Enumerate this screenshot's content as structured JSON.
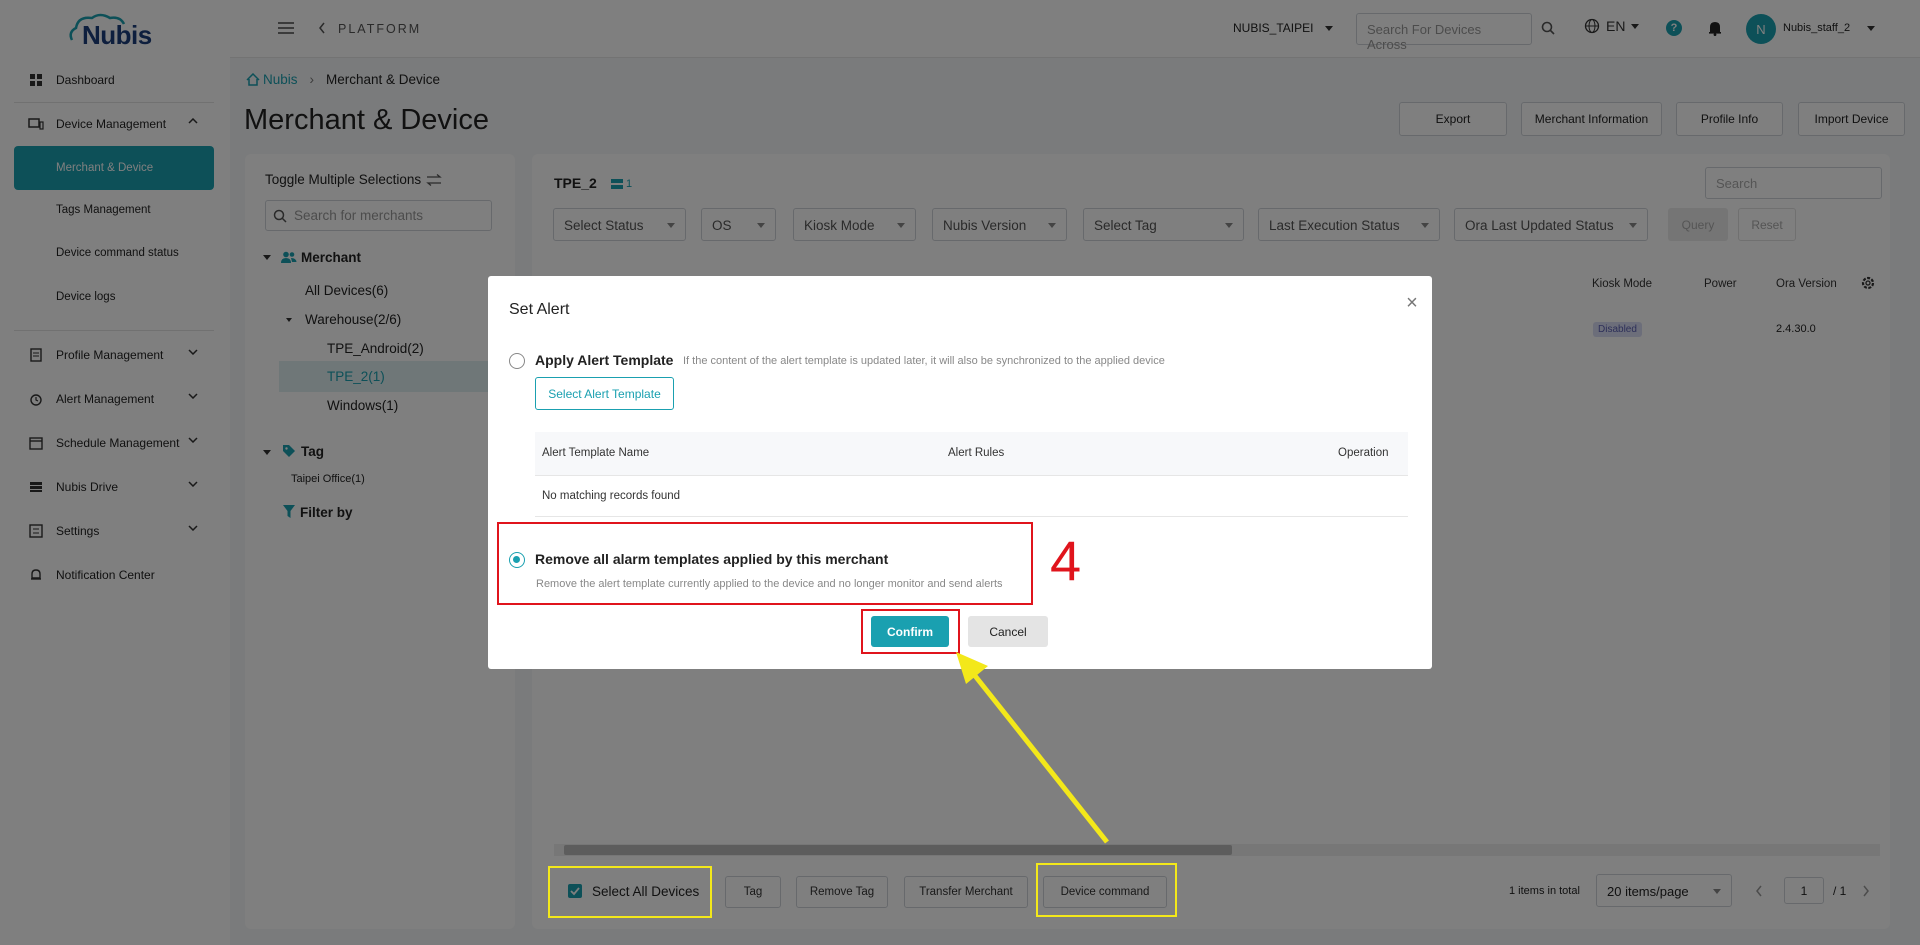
{
  "app": {
    "logo": "Nubis"
  },
  "sidebar": {
    "items": [
      {
        "label": "Dashboard"
      },
      {
        "label": "Device Management"
      },
      {
        "label": "Profile Management"
      },
      {
        "label": "Alert Management"
      },
      {
        "label": "Schedule Management"
      },
      {
        "label": "Nubis Drive"
      },
      {
        "label": "Settings"
      },
      {
        "label": "Notification Center"
      }
    ],
    "sub_items": [
      {
        "label": "Merchant & Device"
      },
      {
        "label": "Tags Management"
      },
      {
        "label": "Device command status"
      },
      {
        "label": "Device logs"
      }
    ]
  },
  "topbar": {
    "section": "PLATFORM",
    "store": "NUBIS_TAIPEI",
    "search_placeholder": "Search For Devices Across",
    "language": "EN",
    "avatar_initial": "N",
    "username": "Nubis_staff_2"
  },
  "page": {
    "breadcrumb_home": "Nubis",
    "breadcrumb_current": "Merchant & Device",
    "title": "Merchant & Device",
    "header_buttons": [
      "Export",
      "Merchant Information",
      "Profile Info",
      "Import Device"
    ]
  },
  "left_panel": {
    "toggle_label": "Toggle Multiple Selections",
    "search_placeholder": "Search for merchants",
    "merchant_heading": "Merchant",
    "all_devices": "All Devices(6)",
    "warehouse": "Warehouse(2/6)",
    "tpe_android": "TPE_Android(2)",
    "tpe_2": "TPE_2(1)",
    "windows": "Windows(1)",
    "tag_heading": "Tag",
    "taipei_office": "Taipei Office(1)",
    "filter_by": "Filter by"
  },
  "right_panel": {
    "title": "TPE_2",
    "count": "1",
    "search_placeholder": "Search",
    "filters": [
      "Select Status",
      "OS",
      "Kiosk Mode",
      "Nubis Version",
      "Select Tag",
      "Last Execution Status",
      "Ora Last Updated Status"
    ],
    "query": "Query",
    "reset": "Reset",
    "columns": [
      "Kiosk Mode",
      "Power",
      "Ora Version"
    ],
    "row": {
      "kiosk": "Disabled",
      "ora": "2.4.30.0"
    }
  },
  "bottom_bar": {
    "select_all": "Select All Devices",
    "tag": "Tag",
    "remove_tag": "Remove Tag",
    "transfer": "Transfer Merchant",
    "device_command": "Device command",
    "total": "1 items in total",
    "page_size": "20 items/page",
    "page": "1",
    "page_total": "/ 1"
  },
  "modal": {
    "title": "Set Alert",
    "option1_title": "Apply Alert Template",
    "option1_desc": "If the content of the alert template is updated later, it will also be synchronized to the applied device",
    "select_template": "Select Alert Template",
    "table_headers": [
      "Alert Template Name",
      "Alert Rules",
      "Operation"
    ],
    "empty_text": "No matching records found",
    "option2_title": "Remove all alarm templates applied by this merchant",
    "option2_desc": "Remove the alert template currently applied to the device and no longer monitor and send alerts",
    "selected_option": 2,
    "confirm": "Confirm",
    "cancel": "Cancel"
  },
  "annotation": {
    "step": "4"
  },
  "colors": {
    "accent": "#1aa0b0",
    "annotation_red": "#e0141c",
    "annotation_yellow": "#f3e81a"
  }
}
